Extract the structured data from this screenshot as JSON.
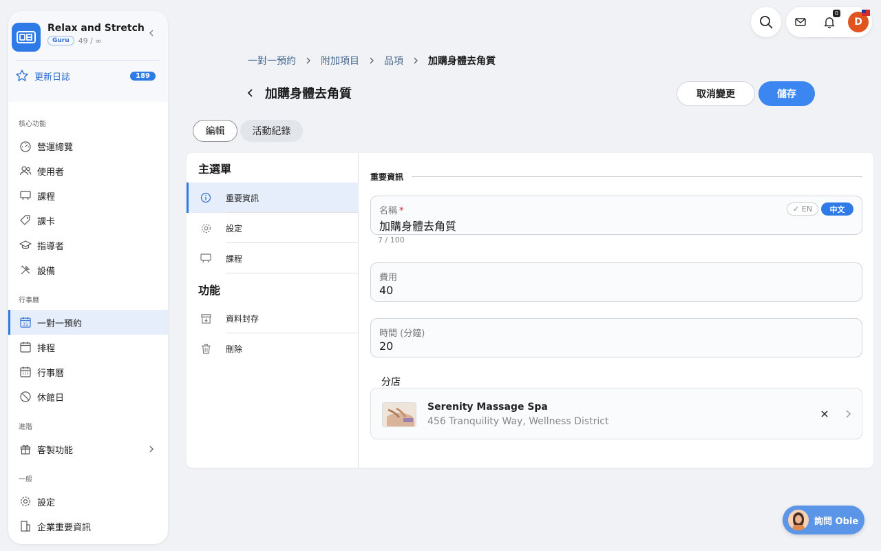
{
  "org": {
    "name": "Relax and Stretch",
    "tier": "Guru",
    "usage": "49 / ∞"
  },
  "changelog": {
    "label": "更新日誌",
    "count": "189"
  },
  "sidebar": {
    "section_core": "核心功能",
    "core": [
      {
        "label": "營運總覽",
        "icon": "dashboard-icon"
      },
      {
        "label": "使用者",
        "icon": "users-icon"
      },
      {
        "label": "課程",
        "icon": "course-icon"
      },
      {
        "label": "課卡",
        "icon": "ticket-icon"
      },
      {
        "label": "指導者",
        "icon": "instructor-icon"
      },
      {
        "label": "設備",
        "icon": "equipment-icon"
      }
    ],
    "section_calendar": "行事曆",
    "calendar": [
      {
        "label": "一對一預約",
        "icon": "calendar-31-icon",
        "active": true
      },
      {
        "label": "排程",
        "icon": "schedule-icon"
      },
      {
        "label": "行事曆",
        "icon": "calendar-grid-icon"
      },
      {
        "label": "休館日",
        "icon": "closed-day-icon"
      }
    ],
    "section_advanced": "進階",
    "advanced": [
      {
        "label": "客製功能",
        "icon": "gift-icon"
      }
    ],
    "section_general": "一般",
    "general": [
      {
        "label": "設定",
        "icon": "gear-icon"
      },
      {
        "label": "企業重要資訊",
        "icon": "building-icon"
      }
    ]
  },
  "header": {
    "notification_count": "0",
    "avatar_initial": "D"
  },
  "breadcrumb": [
    "一對一預約",
    "附加項目",
    "品項",
    "加購身體去角質"
  ],
  "page": {
    "title": "加購身體去角質",
    "cancel_label": "取消變更",
    "save_label": "儲存"
  },
  "tabs": [
    "編輯",
    "活動紀錄"
  ],
  "menu": {
    "main_title": "主選單",
    "main_items": [
      "重要資訊",
      "設定",
      "課程"
    ],
    "func_title": "功能",
    "func_items": [
      "資料封存",
      "刪除"
    ]
  },
  "form": {
    "section_title": "重要資訊",
    "name_label": "名稱",
    "required_mark": "*",
    "lang_en": "✓ EN",
    "lang_zh": "中文",
    "name_value": "加購身體去角質",
    "name_counter": "7 / 100",
    "fee_label": "費用",
    "fee_value": "40",
    "duration_label": "時間 (分鐘)",
    "duration_value": "20",
    "branch_label": "分店",
    "branch_name": "Serenity Massage Spa",
    "branch_address": "456 Tranquility Way, Wellness District"
  },
  "assistant": {
    "label": "詢問 Obie"
  },
  "colors": {
    "accent": "#2e7be8",
    "avatar": "#e2541f"
  }
}
